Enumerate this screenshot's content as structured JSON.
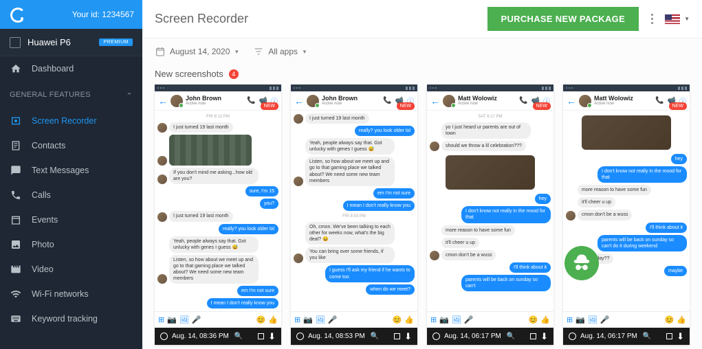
{
  "header": {
    "your_id_label": "Your id: 1234567",
    "page_title": "Screen Recorder",
    "purchase_btn": "PURCHASE NEW PACKAGE"
  },
  "device": {
    "name": "Huawei P6",
    "badge": "PREMIUM"
  },
  "nav": {
    "dashboard": "Dashboard",
    "general_heading": "GENERAL FEATURES",
    "screen_recorder": "Screen Recorder",
    "contacts": "Contacts",
    "text_messages": "Text Messages",
    "calls": "Calls",
    "events": "Events",
    "photo": "Photo",
    "video": "Video",
    "wifi": "Wi-Fi networks",
    "keyword": "Keyword tracking"
  },
  "toolbar": {
    "date": "August 14, 2020",
    "filter": "All apps"
  },
  "section": {
    "new_screenshots": "New screenshots",
    "count": "4",
    "new_badge": "NEW"
  },
  "shots": [
    {
      "contact": "John Brown",
      "status": "Active now",
      "timestamp_foot": "Aug. 14, 08:36 PM",
      "time_label": "FRI 8:12 PM",
      "messages": [
        {
          "type": "in",
          "text": "I just turned 19 last month",
          "av": true
        },
        {
          "type": "img"
        },
        {
          "type": "in",
          "text": "If you don't mind me asking...how old are you?",
          "av": true
        },
        {
          "type": "out",
          "text": "sure, I'm 15"
        },
        {
          "type": "out",
          "text": "you?"
        },
        {
          "type": "in",
          "text": "I just turned 19 last month",
          "av": true
        },
        {
          "type": "out",
          "text": "really? you look older lol"
        },
        {
          "type": "in",
          "text": "Yeah, people always say that. Got unlucky with genes I guess 😅"
        },
        {
          "type": "in",
          "text": "Listen, so how about we meet up and go to that gaming place we talked about? We need some new team members",
          "av": true
        },
        {
          "type": "out",
          "text": "em I'm not sure"
        },
        {
          "type": "out",
          "text": "I mean I don't really know you"
        }
      ]
    },
    {
      "contact": "John Brown",
      "status": "Active now",
      "timestamp_foot": "Aug. 14, 08:53 PM",
      "messages": [
        {
          "type": "in",
          "text": "I just turned 19 last month",
          "av": true
        },
        {
          "type": "out",
          "text": "really? you look older lol"
        },
        {
          "type": "in",
          "text": "Yeah, people always say that. Got unlucky with genes I guess 😅"
        },
        {
          "type": "in",
          "text": "Listen, so how about we meet up and go to that gaming place we talked about? We need some new team members",
          "av": true
        },
        {
          "type": "out",
          "text": "em I'm not sure"
        },
        {
          "type": "out",
          "text": "I mean I don't really know you"
        },
        {
          "type": "ts",
          "text": "FRI 8:53 PM"
        },
        {
          "type": "in",
          "text": "Oh, cmon. We've been talking to each other for weeks now, what's the big deal? 😄"
        },
        {
          "type": "in",
          "text": "You can bring over some friends, if you like",
          "av": true
        },
        {
          "type": "out",
          "text": "I guess I'll ask my friend if he wants to come too"
        },
        {
          "type": "out",
          "text": "when do we meet?"
        }
      ]
    },
    {
      "contact": "Matt Wolowiz",
      "status": "Active now",
      "timestamp_foot": "Aug. 14, 06:17 PM",
      "time_label": "SAT 6:17 PM",
      "messages": [
        {
          "type": "in",
          "text": "yo I just heard ur parents are out of town"
        },
        {
          "type": "in",
          "text": "should we throw a lil celebration???",
          "av": true
        },
        {
          "type": "img2"
        },
        {
          "type": "out",
          "text": "hey"
        },
        {
          "type": "out",
          "text": "I don't know not really in the mood for that"
        },
        {
          "type": "in",
          "text": "more reason to have some fun"
        },
        {
          "type": "in",
          "text": "it'll cheer u up"
        },
        {
          "type": "in",
          "text": "cmon don't be a wuss",
          "av": true
        },
        {
          "type": "out",
          "text": "I'll think about it"
        },
        {
          "type": "out",
          "text": "parents will be back on sunday so can't"
        }
      ]
    },
    {
      "contact": "Matt Wolowiz",
      "status": "Active now",
      "timestamp_foot": "Aug. 14, 06:17 PM",
      "messages": [
        {
          "type": "img2"
        },
        {
          "type": "out",
          "text": "hey"
        },
        {
          "type": "out",
          "text": "I don't know not really in the mood for that"
        },
        {
          "type": "in",
          "text": "more reason to have some fun"
        },
        {
          "type": "in",
          "text": "it'll cheer u up"
        },
        {
          "type": "in",
          "text": "cmon don't be a wuss",
          "av": true
        },
        {
          "type": "out",
          "text": "I'll think about it"
        },
        {
          "type": "out",
          "text": "parents will be back on sunday so can't do it during weekend"
        },
        {
          "type": "in",
          "text": "then friday??",
          "av": true
        },
        {
          "type": "out",
          "text": "maybe"
        }
      ]
    }
  ]
}
